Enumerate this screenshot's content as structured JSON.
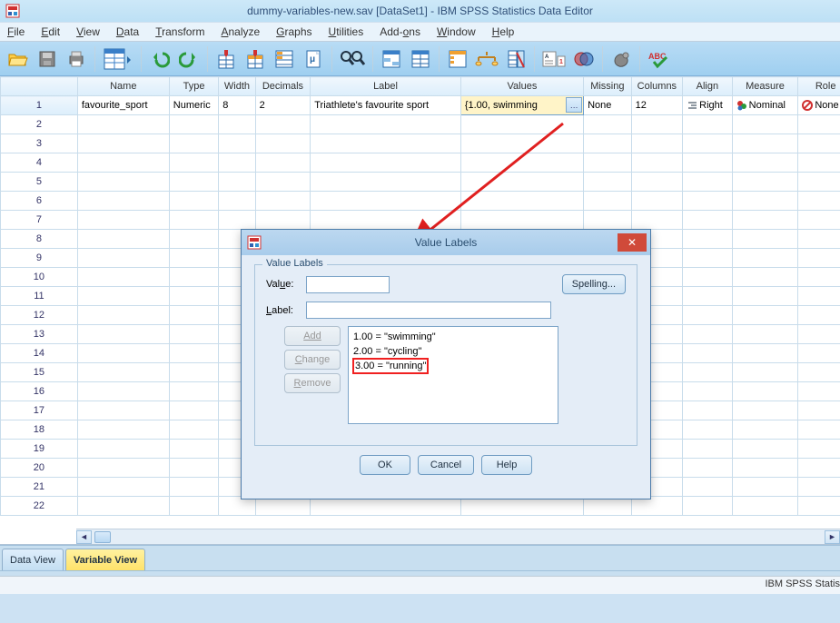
{
  "window": {
    "title": "dummy-variables-new.sav [DataSet1] - IBM SPSS Statistics Data Editor"
  },
  "menu": {
    "file": "File",
    "edit": "Edit",
    "view": "View",
    "data": "Data",
    "transform": "Transform",
    "analyze": "Analyze",
    "graphs": "Graphs",
    "utilities": "Utilities",
    "addons": "Add-ons",
    "window": "Window",
    "help": "Help"
  },
  "columns": {
    "name": "Name",
    "type": "Type",
    "width": "Width",
    "decimals": "Decimals",
    "label": "Label",
    "values": "Values",
    "missing": "Missing",
    "columns": "Columns",
    "align": "Align",
    "measure": "Measure",
    "role": "Role"
  },
  "row": {
    "num": "1",
    "name": "favourite_sport",
    "type": "Numeric",
    "width": "8",
    "decimals": "2",
    "label": "Triathlete's favourite sport",
    "values": "{1.00, swimming",
    "missing": "None",
    "columns": "12",
    "align": "Right",
    "measure": "Nominal",
    "role": "None"
  },
  "blank_rows": [
    "2",
    "3",
    "4",
    "5",
    "6",
    "7",
    "8",
    "9",
    "10",
    "11",
    "12",
    "13",
    "14",
    "15",
    "16",
    "17",
    "18",
    "19",
    "20",
    "21",
    "22"
  ],
  "tabs": {
    "data": "Data View",
    "variable": "Variable View"
  },
  "status": {
    "right": "IBM SPSS Statis"
  },
  "dialog": {
    "title": "Value Labels",
    "groupTitle": "Value Labels",
    "valueLabel": "Value:",
    "labelLabel": "Label:",
    "spelling": "Spelling...",
    "add": "Add",
    "change": "Change",
    "remove": "Remove",
    "ok": "OK",
    "cancel": "Cancel",
    "help": "Help",
    "items": [
      "1.00 = \"swimming\"",
      "2.00 = \"cycling\"",
      "3.00 = \"running\""
    ]
  },
  "icons": {
    "open": "open",
    "save": "save",
    "print": "print",
    "datatbl": "data-table",
    "undo": "undo",
    "redo": "redo",
    "goto": "goto",
    "calc": "compute",
    "recode": "recode",
    "freq": "frequencies",
    "desc": "descriptives",
    "find": "find",
    "select": "select-cases",
    "weight": "weight-cases",
    "split": "split-file",
    "vallab": "value-labels",
    "scale": "scale",
    "bar": "bar",
    "case": "cases",
    "venn": "venn",
    "blob": "blob",
    "spell": "spellcheck"
  }
}
